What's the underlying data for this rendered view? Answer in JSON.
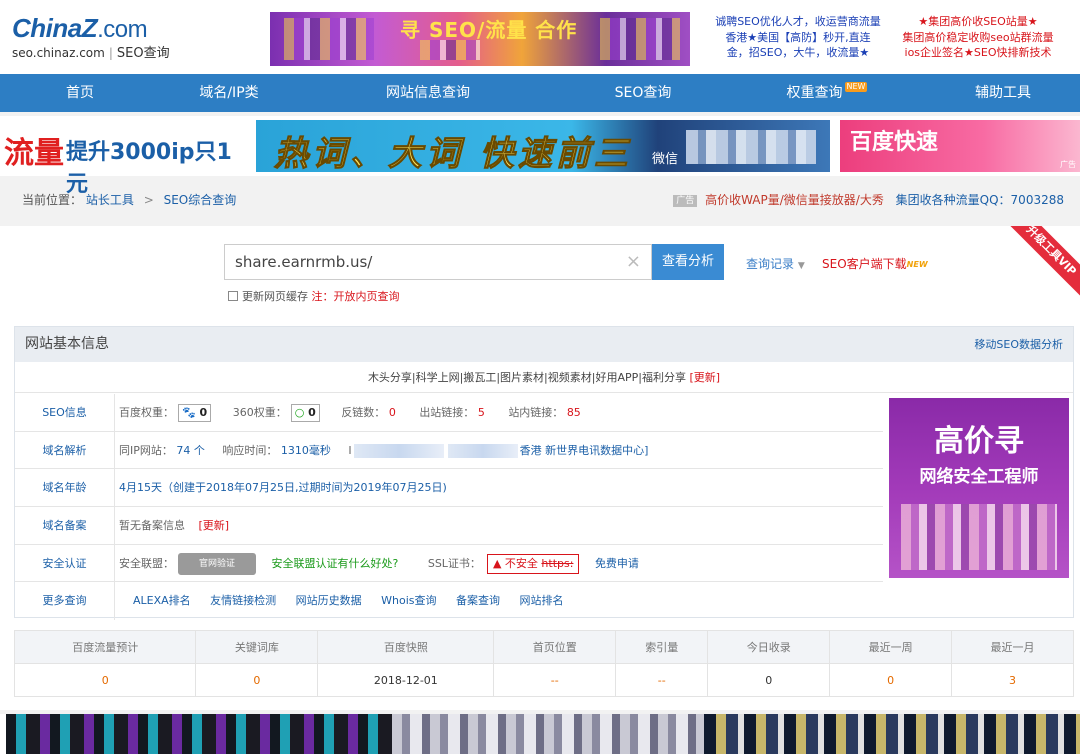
{
  "logo": {
    "brand": "ChinaZ",
    "dotcom": ".com",
    "domain": "seo.chinaz.com",
    "section": "SEO查询"
  },
  "top_banner_text": "寻 SEO/流量 合作",
  "top_ads": {
    "col1": [
      "诚聘SEO优化人才，收运营商流量",
      "香港★美国【高防】秒开,直连",
      "金，招SEO，大牛，收流量★"
    ],
    "col2": [
      "★集团高价收SEO站量★",
      "集团高价稳定收购seo站群流量",
      "ios企业签名★SEO快排新技术"
    ]
  },
  "nav": [
    {
      "label": "首页",
      "w": 110
    },
    {
      "label": "域名/IP类",
      "w": 172
    },
    {
      "label": "网站信息查询",
      "w": 244
    },
    {
      "label": "SEO查询",
      "w": 186
    },
    {
      "label": "权重查询",
      "w": 214,
      "badge": "NEW"
    },
    {
      "label": "辅助工具",
      "w": 154
    }
  ],
  "ad_row": {
    "ad1_big": "流量",
    "ad1_rest": "提升3000ip只1元",
    "ad2_text": "热词、大词 快速前三",
    "ad2_wx": "微信",
    "ad3_text": "百度快速",
    "ad3_tag": "广告"
  },
  "breadcrumb": {
    "prefix": "当前位置：",
    "home": "站长工具",
    "sep": ">",
    "current": "SEO综合查询",
    "ad_tag": "广告",
    "ad_text": "高价收WAP量/微信量接放器/大秀",
    "qq": "集团收各种流量QQ：7003288"
  },
  "search": {
    "value": "share.earnrmb.us/",
    "clear": "×",
    "button": "查看分析",
    "history": "查询记录",
    "history_arrow": "▼",
    "client": "SEO客户端下载",
    "client_new": "NEW",
    "cache_label": "更新网页缓存",
    "cache_note": "注：开放内页查询",
    "vip_ribbon": "升级工具VIP"
  },
  "info": {
    "title": "网站基本信息",
    "mobile_link": "移动SEO数据分析",
    "notice": "木头分享|科学上网|搬瓦工|图片素材|视频素材|好用APP|福利分享",
    "notice_update": "[更新]",
    "rows": {
      "seo": {
        "label": "SEO信息",
        "baidu_label": "百度权重：",
        "baidu_icon": "🐾",
        "baidu_value": "0",
        "w360_label": "360权重：",
        "w360_icon": "○",
        "w360_value": "0",
        "backlinks_label": "反链数：",
        "backlinks": "0",
        "outlinks_label": "出站链接：",
        "outlinks": "5",
        "inlinks_label": "站内链接：",
        "inlinks": "85"
      },
      "dns": {
        "label": "域名解析",
        "sameip_label": "同IP网站：",
        "sameip": "74 个",
        "resp_label": "响应时间：",
        "resp": "1310毫秒",
        "ip_prefix": "I",
        "ip_suffix": "香港 新世界电讯数据中心]"
      },
      "age": {
        "label": "域名年龄",
        "value": "4月15天（创建于2018年07月25日,过期时间为2019年07月25日)"
      },
      "icp": {
        "label": "域名备案",
        "value": "暂无备案信息",
        "update": "[更新]"
      },
      "security": {
        "label": "安全认证",
        "union_label": "安全联盟：",
        "union_badge": "官网验证",
        "union_link": "安全联盟认证有什么好处?",
        "ssl_label": "SSL证书：",
        "ssl_warn": "▲ 不安全",
        "ssl_https": "https:",
        "ssl_apply": "免费申请"
      },
      "more": {
        "label": "更多查询",
        "links": [
          "ALEXA排名",
          "友情链接检测",
          "网站历史数据",
          "Whois查询",
          "备案查询",
          "网站排名"
        ]
      }
    },
    "side_ad": {
      "line1": "高价寻",
      "line2": "网络安全工程师"
    }
  },
  "stats": {
    "headers": [
      "百度流量预计",
      "关键词库",
      "百度快照",
      "首页位置",
      "索引量",
      "今日收录",
      "最近一周",
      "最近一月"
    ],
    "values": [
      "0",
      "0",
      "2018-12-01",
      "--",
      "--",
      "0",
      "0",
      "3"
    ]
  }
}
